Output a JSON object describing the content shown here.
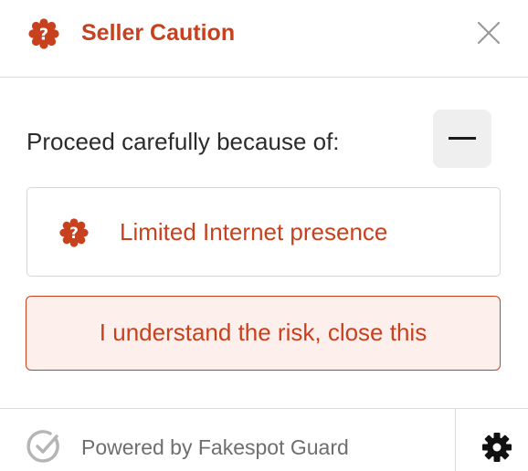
{
  "header": {
    "title": "Seller Caution",
    "icon": "question-badge-icon",
    "close_icon": "close-icon"
  },
  "body": {
    "heading": "Proceed carefully because of:",
    "collapse_icon": "minus-icon",
    "reasons": [
      {
        "label": "Limited Internet presence",
        "icon": "question-badge-icon"
      }
    ],
    "dismiss_label": "I understand the risk, close this"
  },
  "footer": {
    "powered_by": "Powered by Fakespot Guard",
    "check_icon": "check-circle-icon",
    "settings_icon": "gear-icon"
  },
  "colors": {
    "accent": "#c8411f",
    "accent_bg": "#fdf0ec",
    "text": "#2b2b2b",
    "muted": "#6e6e6e",
    "border": "#dcdcdc"
  }
}
